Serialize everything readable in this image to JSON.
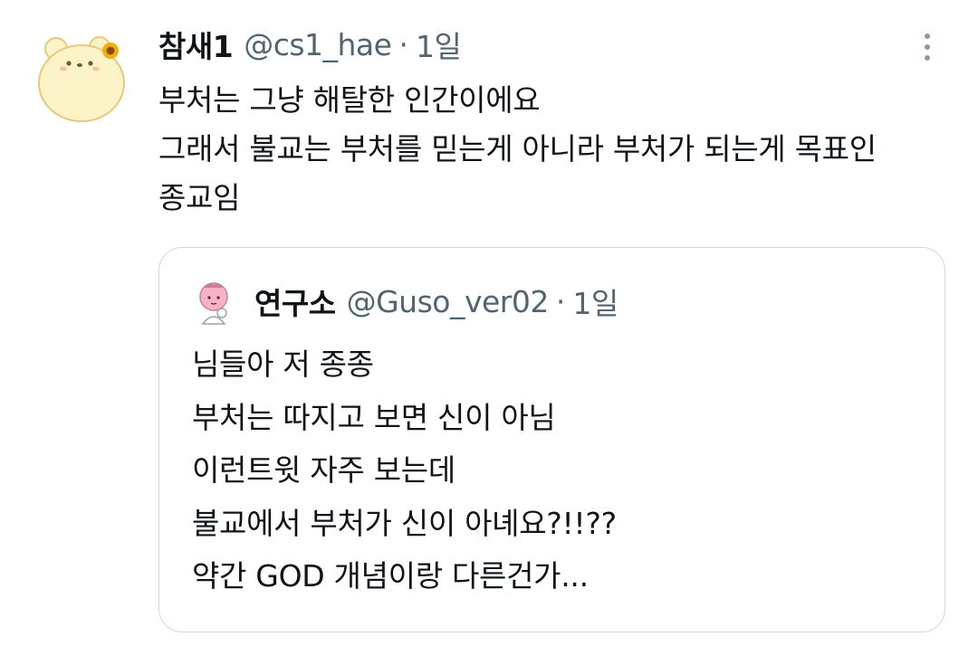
{
  "tweet": {
    "display_name": "참새1",
    "handle": "@cs1_hae",
    "separator": "·",
    "time": "1일",
    "avatar_icon": "bear-with-sunflower-avatar-icon",
    "more_icon": "more-options-vertical-dots-icon",
    "lines": [
      "부처는 그냥 해탈한 인간이에요",
      "그래서 불교는 부처를 믿는게 아니라 부처가 되는게 목표인",
      "종교임"
    ]
  },
  "quoted_tweet": {
    "display_name": "연구소",
    "handle": "@Guso_ver02",
    "separator": "·",
    "time": "1일",
    "avatar_icon": "pink-character-avatar-icon",
    "lines": [
      "님들아 저 종종",
      "부처는 따지고 보면 신이 아님",
      "이런트윗 자주 보는데",
      "불교에서 부처가 신이 아녜요?!!??",
      "약간 GOD 개념이랑 다른건가..."
    ]
  },
  "colors": {
    "text_primary": "#0f1419",
    "text_secondary": "#536471",
    "border": "#cfd9de",
    "avatar_fill": "#fdf3c8",
    "avatar_outline": "#e8c97a",
    "sunflower": "#f4b000",
    "quote_avatar_pink": "#f5b3c5"
  }
}
